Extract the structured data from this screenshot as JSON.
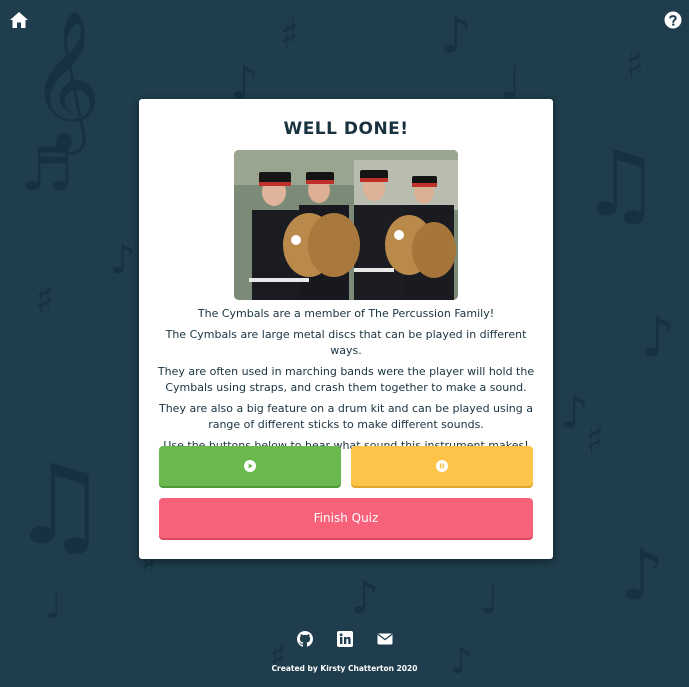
{
  "theme": {
    "background": "#1f3d4c",
    "card": "#ffffff",
    "play_button": "#6bb84f",
    "pause_button": "#fdc449",
    "finish_button": "#f7627a",
    "text": "#1a3340"
  },
  "nav": {
    "home_icon": "home-icon",
    "help_icon": "question-circle-icon"
  },
  "result": {
    "title": "WELL DONE!",
    "image_description": "cymbals-players-photo",
    "paragraphs": [
      "The Cymbals are a member of The Percussion Family!",
      "The Cymbals are large metal discs that can be played in different ways.",
      "They are often used in marching bands were the player will hold the Cymbals using straps, and crash them together to make a sound.",
      "They are also a big feature on a drum kit and can be played using a range of different sticks to make different sounds.",
      "Use the buttons below to hear what sound this instrument makes!"
    ],
    "play_icon": "play-circle-icon",
    "pause_icon": "pause-circle-icon",
    "finish_label": "Finish Quiz"
  },
  "footer": {
    "icons": [
      "github-icon",
      "linkedin-icon",
      "envelope-icon"
    ],
    "credit": "Created by Kirsty Chatterton 2020"
  }
}
